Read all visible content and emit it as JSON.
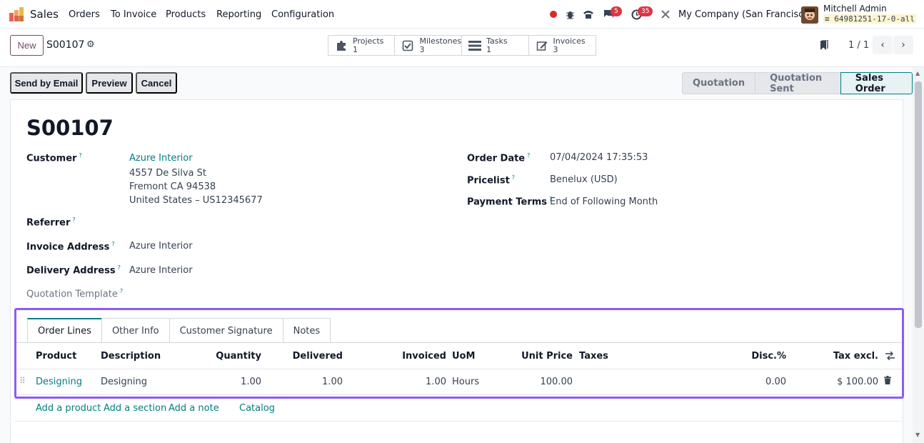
{
  "navbar": {
    "app_name": "Sales",
    "menu": [
      "Orders",
      "To Invoice",
      "Products",
      "Reporting",
      "Configuration"
    ],
    "chat_count": "5",
    "activity_count": "35",
    "company": "My Company (San Francisco)",
    "user_name": "Mitchell Admin",
    "db_name": "64981251-17-0-all"
  },
  "control": {
    "new_label": "New",
    "record_ref": "S00107",
    "smart_buttons": [
      {
        "label": "Projects",
        "count": "1",
        "icon": "puzzle-icon"
      },
      {
        "label": "Milestones",
        "count": "3",
        "icon": "check-square-icon"
      },
      {
        "label": "Tasks",
        "count": "1",
        "icon": "tasks-icon"
      },
      {
        "label": "Invoices",
        "count": "3",
        "icon": "edit-icon"
      }
    ],
    "pager": "1 / 1"
  },
  "actions": {
    "send_email": "Send by Email",
    "preview": "Preview",
    "cancel": "Cancel"
  },
  "status": {
    "stages": [
      "Quotation",
      "Quotation Sent",
      "Sales Order"
    ],
    "active": "Sales Order"
  },
  "form": {
    "title": "S00107",
    "customer_label": "Customer",
    "customer_name": "Azure Interior",
    "address_line1": "4557 De Silva St",
    "address_line2": "Fremont CA 94538",
    "address_line3": "United States – US12345677",
    "referrer_label": "Referrer",
    "invoice_address_label": "Invoice Address",
    "invoice_address": "Azure Interior",
    "delivery_address_label": "Delivery Address",
    "delivery_address": "Azure Interior",
    "quotation_template_label": "Quotation Template",
    "order_date_label": "Order Date",
    "order_date": "07/04/2024 17:35:53",
    "pricelist_label": "Pricelist",
    "pricelist": "Benelux (USD)",
    "payment_terms_label": "Payment Terms",
    "payment_terms": "End of Following Month",
    "tooltip_mark": "?"
  },
  "tabs": [
    "Order Lines",
    "Other Info",
    "Customer Signature",
    "Notes"
  ],
  "order_lines": {
    "columns": [
      "Product",
      "Description",
      "Quantity",
      "Delivered",
      "Invoiced",
      "UoM",
      "Unit Price",
      "Taxes",
      "Disc.%",
      "Tax excl."
    ],
    "rows": [
      {
        "product": "Designing",
        "description": "Designing",
        "quantity": "1.00",
        "delivered": "1.00",
        "invoiced": "1.00",
        "uom": "Hours",
        "unit_price": "100.00",
        "taxes": "",
        "discount": "0.00",
        "subtotal": "$ 100.00"
      }
    ],
    "add_links": [
      "Add a product",
      "Add a section",
      "Add a note",
      "Catalog"
    ]
  },
  "colors": {
    "brand": "#714b67",
    "accent": "#017e84",
    "highlight": "#8b5cf6"
  }
}
